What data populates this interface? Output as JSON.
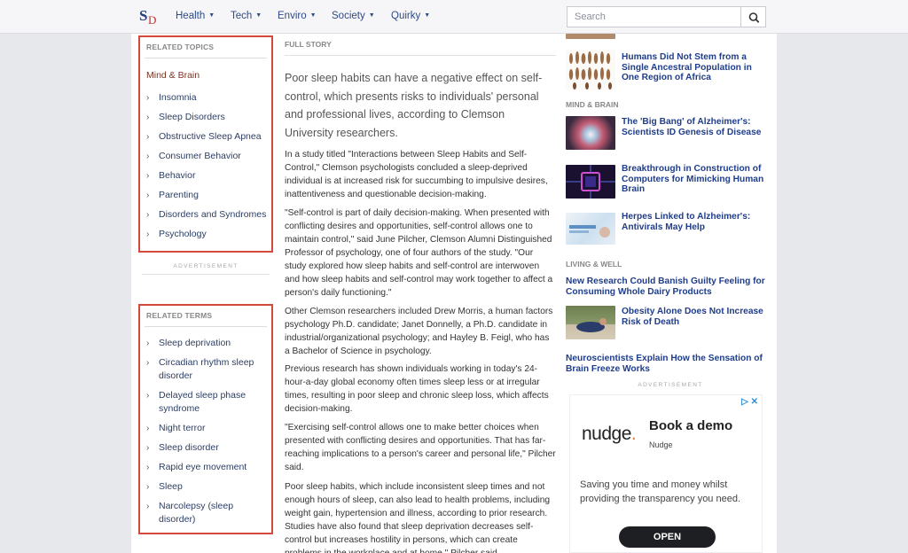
{
  "nav": {
    "logo_s": "S",
    "logo_d": "D",
    "items": [
      {
        "label": "Health",
        "caret": "▼"
      },
      {
        "label": "Tech",
        "caret": "▼"
      },
      {
        "label": "Enviro",
        "caret": "▼"
      },
      {
        "label": "Society",
        "caret": "▼"
      },
      {
        "label": "Quirky",
        "caret": "▼"
      }
    ],
    "search_placeholder": "Search"
  },
  "related_topics": {
    "heading": "RELATED TOPICS",
    "category": "Mind & Brain",
    "items": [
      "Insomnia",
      "Sleep Disorders",
      "Obstructive Sleep Apnea",
      "Consumer Behavior",
      "Behavior",
      "Parenting",
      "Disorders and Syndromes",
      "Psychology"
    ]
  },
  "ad_label": "ADVERTISEMENT",
  "related_terms": {
    "heading": "RELATED TERMS",
    "items": [
      "Sleep deprivation",
      "Circadian rhythm sleep disorder",
      "Delayed sleep phase syndrome",
      "Night terror",
      "Sleep disorder",
      "Rapid eye movement",
      "Sleep",
      "Narcolepsy (sleep disorder)"
    ]
  },
  "article": {
    "heading": "FULL STORY",
    "lead": "Poor sleep habits can have a negative effect on self-control, which presents risks to individuals' personal and professional lives, according to Clemson University researchers.",
    "paragraphs": [
      "In a study titled \"Interactions between Sleep Habits and Self-Control,\" Clemson psychologists concluded a sleep-deprived individual is at increased risk for succumbing to impulsive desires, inattentiveness and questionable decision-making.",
      "\"Self-control is part of daily decision-making. When presented with conflicting desires and opportunities, self-control allows one to maintain control,\" said June Pilcher, Clemson Alumni Distinguished Professor of psychology, one of four authors of the study. \"Our study explored how sleep habits and self-control are interwoven and how sleep habits and self-control may work together to affect a person's daily functioning.\"",
      "Other Clemson researchers included Drew Morris, a human factors psychology Ph.D. candidate; Janet Donnelly, a Ph.D. candidate in industrial/organizational psychology; and Hayley B. Feigl, who has a Bachelor of Science in psychology.",
      "Previous research has shown individuals working in today's 24-hour-a-day global economy often times sleep less or at irregular times, resulting in poor sleep and chronic sleep loss, which affects decision-making.",
      "\"Exercising self-control allows one to make better choices when presented with conflicting desires and opportunities. That has far-reaching implications to a person's career and personal life,\" Pilcher said.",
      "Poor sleep habits, which include inconsistent sleep times and not enough hours of sleep, can also lead to health problems, including weight gain, hypertension and illness, according to prior research. Studies have also found that sleep deprivation decreases self-control but increases hostility in persons, which can create problems in the workplace and at home,\" Pilcher said."
    ]
  },
  "sidebar": {
    "top_story": "Humans Did Not Stem from a Single Ancestral Population in One Region of Africa",
    "mind_brain": {
      "heading": "MIND & BRAIN",
      "stories": [
        "The 'Big Bang' of Alzheimer's: Scientists ID Genesis of Disease",
        "Breakthrough in Construction of Computers for Mimicking Human Brain",
        "Herpes Linked to Alzheimer's: Antivirals May Help"
      ]
    },
    "living_well": {
      "heading": "LIVING & WELL",
      "stories": [
        "New Research Could Banish Guilty Feeling for Consuming Whole Dairy Products",
        "Obesity Alone Does Not Increase Risk of Death",
        "Neuroscientists Explain How the Sensation of Brain Freeze Works"
      ]
    }
  },
  "ad": {
    "badge": "▷ ✕",
    "logo": "nudge",
    "logo_dot": ".",
    "title": "Book a demo",
    "brand": "Nudge",
    "text": "Saving you time and money whilst providing the transparency you need.",
    "button": "OPEN"
  }
}
